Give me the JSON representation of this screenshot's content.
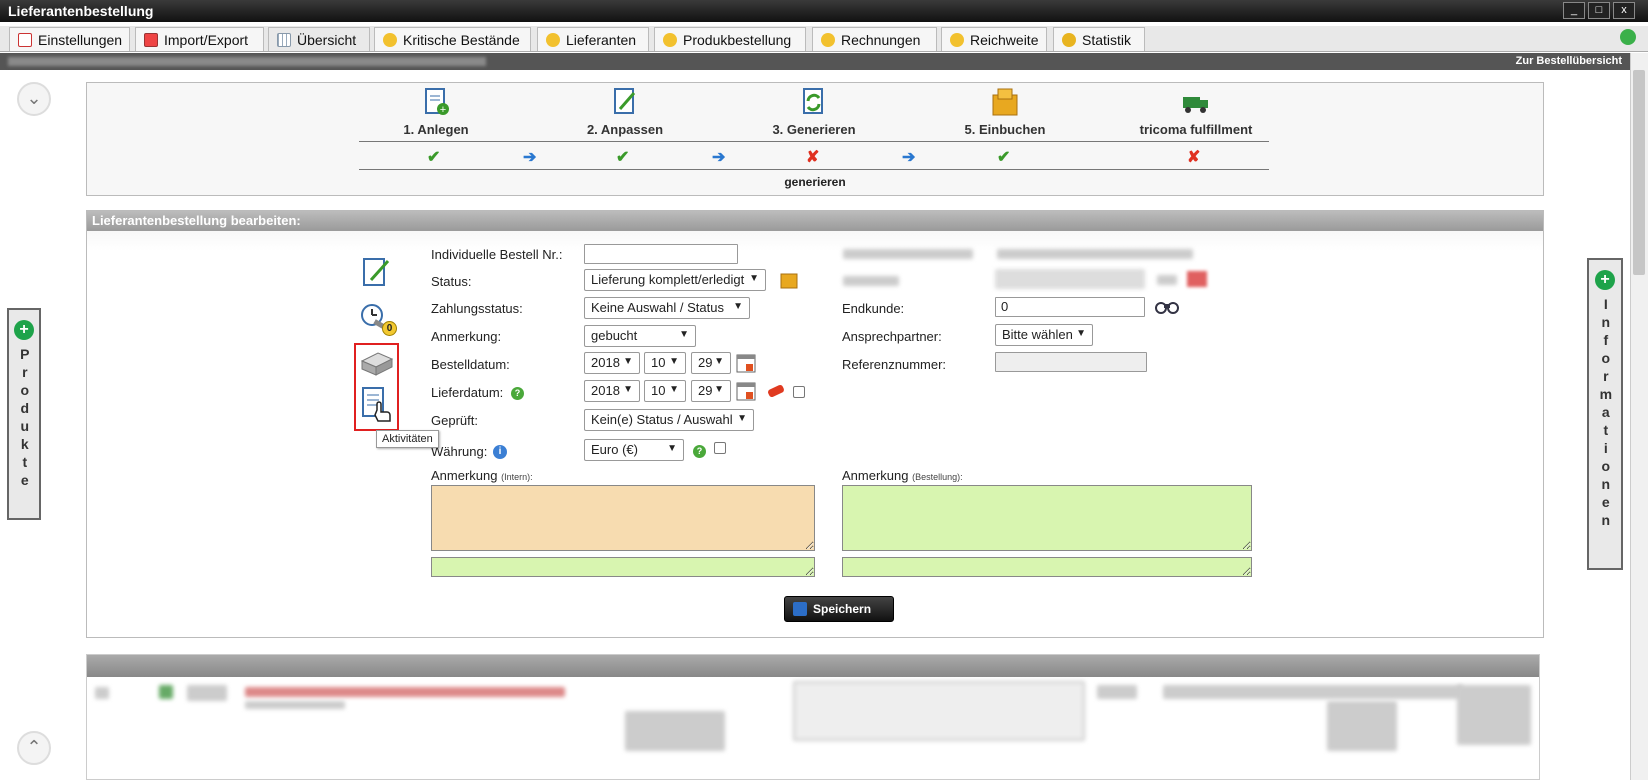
{
  "window": {
    "title": "Lieferantenbestellung",
    "buttons": [
      "_",
      "□",
      "x"
    ]
  },
  "tabs": [
    {
      "label": "Einstellungen",
      "icon": "checklist-icon"
    },
    {
      "label": "Import/Export",
      "icon": "import-icon"
    },
    {
      "label": "Übersicht",
      "icon": "grid-icon"
    },
    {
      "label": "Kritische Bestände",
      "icon": "crown-icon"
    },
    {
      "label": "Lieferanten",
      "icon": "crown-icon"
    },
    {
      "label": "Produkbestellung",
      "icon": "crown-icon"
    },
    {
      "label": "Rechnungen",
      "icon": "crown-icon"
    },
    {
      "label": "Reichweite",
      "icon": "crown-icon"
    },
    {
      "label": "Statistik",
      "icon": "medal-icon"
    }
  ],
  "infobar": {
    "link": "Zur Bestellübersicht"
  },
  "workflow": {
    "steps": [
      {
        "label": "1. Anlegen",
        "status": "ok"
      },
      {
        "label": "2. Anpassen",
        "status": "ok"
      },
      {
        "label": "3. Generieren",
        "status": "fail"
      },
      {
        "label": "5. Einbuchen",
        "status": "ok"
      },
      {
        "label": "tricoma fulfillment",
        "status": "fail"
      }
    ],
    "footer": "generieren"
  },
  "edit": {
    "header": "Lieferantenbestellung bearbeiten:",
    "fields": {
      "bestellnr_label": "Individuelle Bestell Nr.:",
      "bestellnr_value": "",
      "status_label": "Status:",
      "status_value": "Lieferung komplett/erledigt",
      "zahlung_label": "Zahlungsstatus:",
      "zahlung_value": "Keine Auswahl / Status",
      "anmerkung_label": "Anmerkung:",
      "anmerkung_value": "gebucht",
      "bestelldatum_label": "Bestelldatum:",
      "bestelldatum": {
        "year": "2018",
        "month": "10",
        "day": "29"
      },
      "lieferdatum_label": "Lieferdatum:",
      "lieferdatum": {
        "year": "2018",
        "month": "10",
        "day": "29"
      },
      "geprueft_label": "Geprüft:",
      "geprueft_value": "Kein(e) Status / Auswahl",
      "waehrung_label": "Währung:",
      "waehrung_value": "Euro (€)",
      "endkunde_label": "Endkunde:",
      "endkunde_value": "0",
      "ansprech_label": "Ansprechpartner:",
      "ansprech_value": "Bitte wählen",
      "referenz_label": "Referenznummer:",
      "referenz_value": "",
      "anm_intern_label": "Anmerkung",
      "anm_intern_small": "(Intern):",
      "anm_best_label": "Anmerkung",
      "anm_best_small": "(Bestellung):"
    },
    "save_label": "Speichern",
    "tooltip": "Aktivitäten",
    "badge_count": "0"
  },
  "sidetabs": {
    "left": "Produkte",
    "right": "Informationen"
  },
  "colors": {
    "intern_bg": "#f7dcb0",
    "bestellung_bg": "#d8f5b0",
    "ok": "#3a9a2a",
    "fail": "#e03020",
    "arrow": "#2a78d0"
  }
}
